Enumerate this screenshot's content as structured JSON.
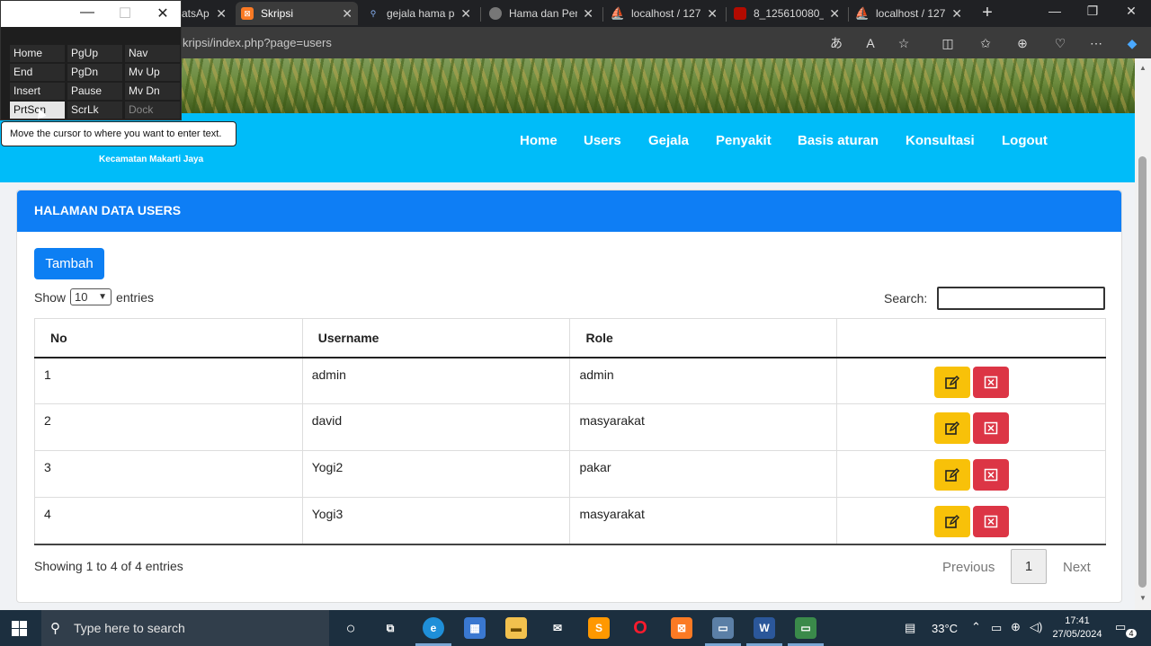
{
  "browser": {
    "tabs": [
      {
        "title": "atsAp",
        "favicon": "whatsapp-icon",
        "color": "#202124"
      },
      {
        "title": "Skripsi",
        "favicon": "xampp-icon",
        "color": "#fb7a24"
      },
      {
        "title": "gejala hama pa",
        "favicon": "search-icon",
        "color": "#1a73e8"
      },
      {
        "title": "Hama dan Pen",
        "favicon": "globe-icon",
        "color": "#777777"
      },
      {
        "title": "localhost / 127",
        "favicon": "phpmyadmin-icon",
        "color": "#f29111"
      },
      {
        "title": "8_125610080_",
        "favicon": "pdf-icon",
        "color": "#b30b00"
      },
      {
        "title": "localhost / 127",
        "favicon": "phpmyadmin-icon",
        "color": "#f29111"
      }
    ],
    "url": "kripsi/index.php?page=users"
  },
  "osk": {
    "keys": [
      [
        "Home",
        "PgUp",
        "Nav"
      ],
      [
        "End",
        "PgDn",
        "Mv Up"
      ],
      [
        "Insert",
        "Pause",
        "Mv Dn"
      ],
      [
        "PrtScn",
        "ScrLk",
        "Dock"
      ]
    ],
    "tooltip": "Move the cursor to where you want to enter text."
  },
  "site": {
    "subtitle": "Kecamatan Makarti Jaya",
    "nav": [
      "Home",
      "Users",
      "Gejala",
      "Penyakit",
      "Basis aturan",
      "Konsultasi",
      "Logout"
    ]
  },
  "card": {
    "title": "HALAMAN DATA USERS",
    "add_button": "Tambah",
    "show_label": "Show",
    "entries_label": "entries",
    "page_length": "10",
    "search_label": "Search:",
    "search_value": "",
    "columns": [
      "No",
      "Username",
      "Role",
      ""
    ],
    "rows": [
      {
        "no": "1",
        "username": "admin",
        "role": "admin"
      },
      {
        "no": "2",
        "username": "david",
        "role": "masyarakat"
      },
      {
        "no": "3",
        "username": "Yogi2",
        "role": "pakar"
      },
      {
        "no": "4",
        "username": "Yogi3",
        "role": "masyarakat"
      }
    ],
    "info": "Showing 1 to 4 of 4 entries",
    "pager": {
      "previous": "Previous",
      "page": "1",
      "next": "Next"
    }
  },
  "colors": {
    "navbar": "#00bcf9",
    "card_header": "#0e7ef5",
    "edit_button": "#f8c109",
    "delete_button": "#dc3545"
  },
  "taskbar": {
    "search_placeholder": "Type here to search",
    "temperature": "33°C",
    "time": "17:41",
    "date": "27/05/2024",
    "notifications": "4"
  }
}
